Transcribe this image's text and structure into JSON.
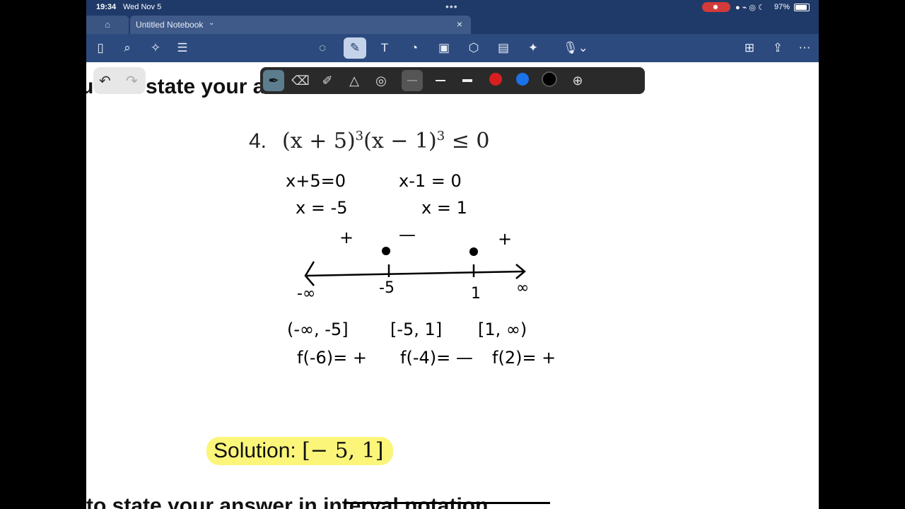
{
  "status_bar": {
    "time": "19:34",
    "date": "Wed Nov 5",
    "battery": "97%"
  },
  "tabs": {
    "home_icon": "home-icon",
    "document_title": "Untitled Notebook"
  },
  "toolbar": {
    "left_icons": [
      "sidebar-icon",
      "search-icon",
      "ai-sparkle-icon",
      "page-list-icon"
    ],
    "center_icons": [
      "lasso-icon",
      "pen-icon",
      "text-box-icon",
      "shapes-icon",
      "image-icon",
      "elements-icon",
      "sticky-note-icon",
      "laser-pointer-icon",
      "audio-record-icon"
    ],
    "right_icons": [
      "add-page-icon",
      "share-icon",
      "more-icon"
    ]
  },
  "page": {
    "top_heading_prefix": "u",
    "top_heading": "state your a",
    "problem_number": "4.",
    "problem_expr_a": "(x + 5)",
    "problem_exp_a": "3",
    "problem_expr_b": "(x − 1)",
    "problem_exp_b": "3",
    "problem_rhs": "≤ 0",
    "handwriting": {
      "eq1": "x+5=0",
      "eq2": "x-1 = 0",
      "sol1": "x = -5",
      "sol2": "x = 1",
      "sign1": "+",
      "sign2": "—",
      "sign3": "+",
      "tick_neg_inf": "-∞",
      "tick_a": "-5",
      "tick_b": "1",
      "tick_pos_inf": "∞",
      "interval1": "(-∞, -5]",
      "interval2": "[-5, 1]",
      "interval3": "[1, ∞)",
      "test1": "f(-6)= +",
      "test2": "f(-4)=  —",
      "test3": "f(2)=   +"
    },
    "solution_label": "Solution:",
    "solution_value": "[− 5, 1]",
    "bottom_heading": "to state your answer in interval notation."
  },
  "pen_toolbar": {
    "tools": [
      "pen-tool-icon",
      "eraser-icon",
      "highlighter-icon",
      "shape-tool-icon",
      "lasso-select-icon"
    ],
    "colors": [
      "#d71f1f",
      "#1a73e8",
      "#000000"
    ]
  }
}
